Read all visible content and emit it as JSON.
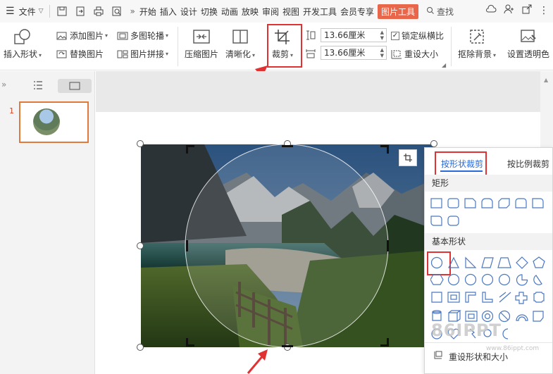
{
  "menubar": {
    "file": "文件",
    "tabs": [
      "开始",
      "插入",
      "设计",
      "切换",
      "动画",
      "放映",
      "审阅",
      "视图",
      "开发工具",
      "会员专享"
    ],
    "active_tab": "图片工具",
    "search": "查找"
  },
  "ribbon": {
    "insert_shape": "插入形状",
    "add_picture": "添加图片",
    "multi_carousel": "多图轮播",
    "replace_picture": "替换图片",
    "picture_collage": "图片拼接",
    "compress": "压缩图片",
    "clarity": "清晰化",
    "crop": "裁剪",
    "height_value": "13.66厘米",
    "width_value": "13.66厘米",
    "lock_ratio": "锁定纵横比",
    "reset_size": "重设大小",
    "remove_bg": "抠除背景",
    "set_transparent": "设置透明色"
  },
  "leftpanel": {
    "slide_number": "1"
  },
  "cropmenu": {
    "tab_shape": "按形状裁剪",
    "tab_ratio": "按比例裁剪",
    "section_rect": "矩形",
    "section_basic": "基本形状",
    "footer": "重设形状和大小"
  },
  "watermark": {
    "text": "86IPPT",
    "sub": "www.86ippt.com"
  },
  "colors": {
    "accent": "#e8674a",
    "highlight": "#e03232",
    "link": "#2a6ad8"
  }
}
